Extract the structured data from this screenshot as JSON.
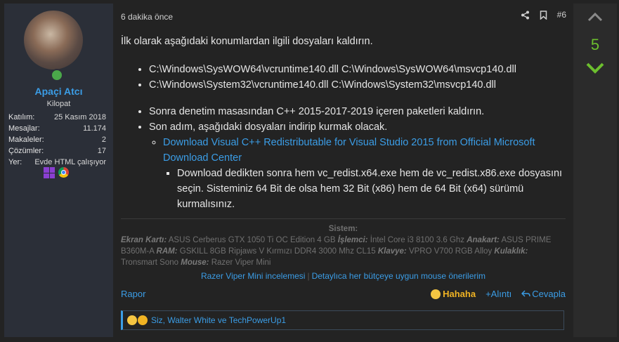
{
  "user": {
    "name": "Apaçi Atcı",
    "title": "Kilopat",
    "stats": [
      {
        "label": "Katılım:",
        "value": "25 Kasım 2018"
      },
      {
        "label": "Mesajlar:",
        "value": "11.174"
      },
      {
        "label": "Makaleler:",
        "value": "2"
      },
      {
        "label": "Çözümler:",
        "value": "17"
      },
      {
        "label": "Yer:",
        "value": "Evde HTML çalışıyor"
      }
    ]
  },
  "post": {
    "time": "6 dakika önce",
    "number": "#6",
    "intro": "İlk olarak aşağıdaki konumlardan ilgili dosyaları kaldırın.",
    "paths": [
      "C:\\Windows\\SysWOW64\\vcruntime140.dll C:\\Windows\\SysWOW64\\msvcp140.dll",
      "C:\\Windows\\System32\\vcruntime140.dll C:\\Windows\\System32\\msvcp140.dll"
    ],
    "step1": "Sonra denetim masasından C++ 2015-2017-2019 içeren paketleri kaldırın.",
    "step2": "Son adım, aşağıdaki dosyaları indirip kurmak olacak.",
    "download_link": "Download Visual C++ Redistributable for Visual Studio 2015 from Official Microsoft Download Center",
    "download_note": "Download dedikten sonra hem vc_redist.x64.exe hem de vc_redist.x86.exe dosyasını seçin. Sisteminiz 64 Bit de olsa hem 32 Bit (x86) hem de 64 Bit (x64) sürümü kurmalısınız."
  },
  "signature": {
    "title": "Sistem:",
    "items": [
      {
        "label": "Ekran Kartı:",
        "value": "ASUS Cerberus GTX 1050 Ti OC Edition 4 GB"
      },
      {
        "label": "İşlemci:",
        "value": "İntel Core i3 8100 3.6 Ghz"
      },
      {
        "label": "Anakart:",
        "value": "ASUS PRIME B360M-A"
      },
      {
        "label": "RAM:",
        "value": "GSKILL 8GB Ripjaws V Kırmızı DDR4 3000 Mhz CL15"
      },
      {
        "label": "Klavye:",
        "value": "VPRO V700 RGB Alloy"
      },
      {
        "label": "Kulaklık:",
        "value": "Tronsmart Sono"
      },
      {
        "label": "Mouse:",
        "value": "Razer Viper Mini"
      }
    ],
    "link1": "Razer Viper Mini incelemesi",
    "link_sep": "|",
    "link2": "Detaylıca her bütçeye uygun mouse önerilerim"
  },
  "footer": {
    "report": "Rapor",
    "reaction": "Hahaha",
    "quote": "+Alıntı",
    "reply": "Cevapla"
  },
  "reactions_text": "Siz, Walter White ve TechPowerUp1",
  "vote": {
    "count": "5"
  },
  "colors": {
    "accent": "#3b9de6",
    "vote_green": "#6cbf2e",
    "reaction_gold": "#f0b323"
  }
}
